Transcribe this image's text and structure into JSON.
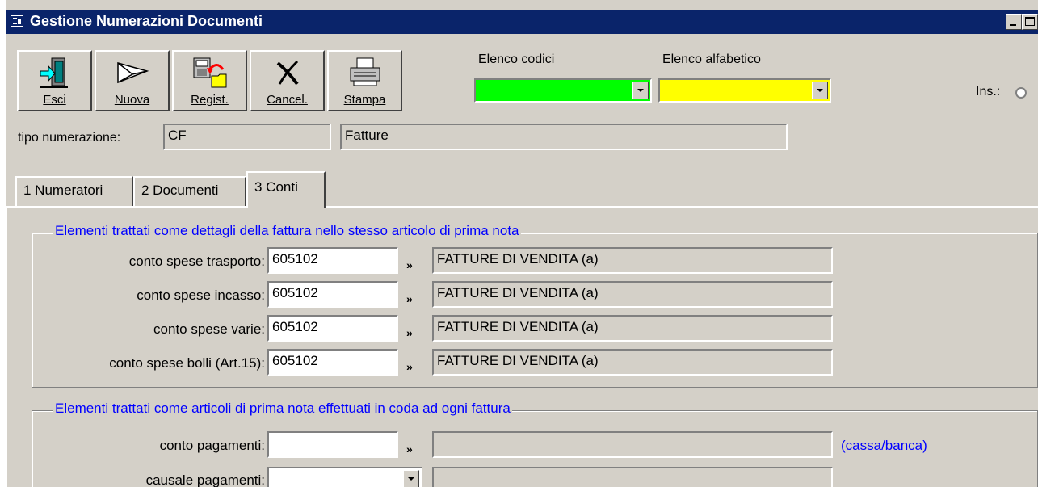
{
  "window": {
    "title": "Gestione Numerazioni Documenti",
    "minimize_label": "_",
    "maximize_label": "□"
  },
  "toolbar": {
    "buttons": [
      {
        "label": "Esci",
        "icon": "exit-door-icon"
      },
      {
        "label": "Nuova",
        "icon": "new-envelope-icon"
      },
      {
        "label": "Regist.",
        "icon": "save-register-icon"
      },
      {
        "label": "Cancel.",
        "icon": "delete-x-icon"
      },
      {
        "label": "Stampa",
        "icon": "printer-icon"
      }
    ]
  },
  "lists": {
    "codici_label": "Elenco codici",
    "codici_color": "#00ff00",
    "alfabetico_label": "Elenco alfabetico",
    "alfabetico_color": "#ffff00"
  },
  "ins_label": "Ins.:",
  "tipo": {
    "label": "tipo numerazione:",
    "code": "CF",
    "description": "Fatture"
  },
  "tabs": [
    {
      "label": "1 Numeratori",
      "active": false
    },
    {
      "label": "2 Documenti",
      "active": false
    },
    {
      "label": "3 Conti",
      "active": true
    }
  ],
  "group1": {
    "title": "Elementi trattati come dettagli della fattura nello stesso articolo di prima nota",
    "rows": [
      {
        "label": "conto spese trasporto:",
        "code": "605102",
        "chevron": "»",
        "description": "FATTURE DI VENDITA (a)"
      },
      {
        "label": "conto spese incasso:",
        "code": "605102",
        "chevron": "»",
        "description": "FATTURE DI VENDITA (a)"
      },
      {
        "label": "conto spese varie:",
        "code": "605102",
        "chevron": "»",
        "description": "FATTURE DI VENDITA (a)"
      },
      {
        "label": "conto spese bolli (Art.15):",
        "code": "605102",
        "chevron": "»",
        "description": "FATTURE DI VENDITA (a)"
      }
    ]
  },
  "group2": {
    "title": "Elementi trattati come articoli di prima nota effettuati in coda ad ogni fattura",
    "rows": [
      {
        "label": "conto pagamenti:",
        "code": "",
        "chevron": "»",
        "description": "",
        "note": "(cassa/banca)"
      },
      {
        "label": "causale pagamenti:",
        "code": "",
        "description": ""
      }
    ]
  }
}
